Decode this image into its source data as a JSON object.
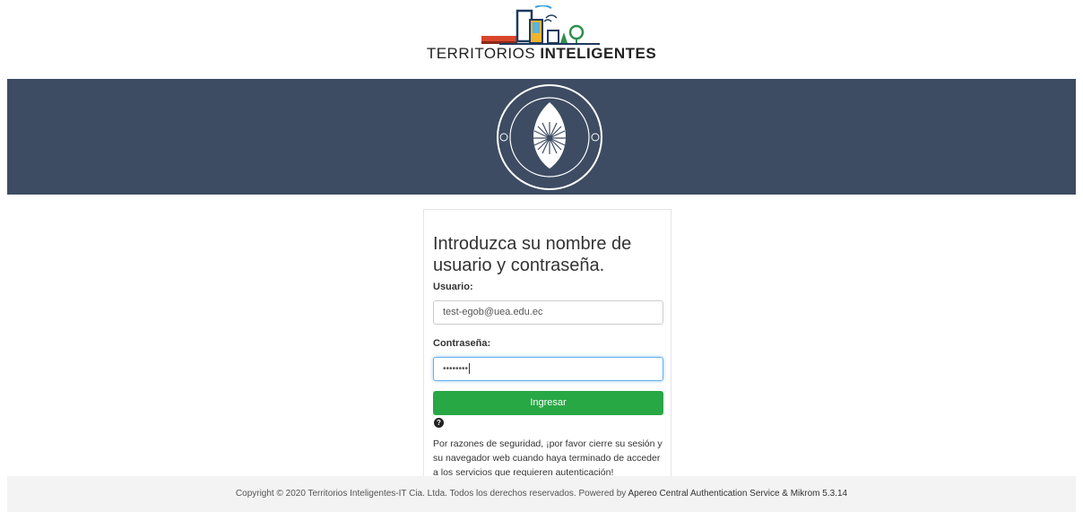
{
  "brand": {
    "name_part1": "TERRITORIOS ",
    "name_part2": "INTELIGENTES"
  },
  "login": {
    "title": "Introduzca su nombre de usuario y contraseña.",
    "username_label": "Usuario:",
    "username_value": "test-egob@uea.edu.ec",
    "password_label": "Contraseña:",
    "password_masked": "••••••••",
    "submit_label": "Ingresar",
    "help_icon": "question-circle-icon",
    "security_note": "Por razones de seguridad, ¡por favor cierre su sesión y su navegador web cuando haya terminado de acceder a los servicios que requieren autenticación!"
  },
  "footer": {
    "copyright": "Copyright © 2020 Territorios Inteligentes-IT Cia. Ltda. Todos los derechos reservados. Powered by ",
    "link_text": "Apereo Central Authentication Service & Mikrom 5.3.14"
  },
  "colors": {
    "banner": "#3d4c63",
    "button": "#28a745",
    "footer": "#f3f3f3"
  }
}
